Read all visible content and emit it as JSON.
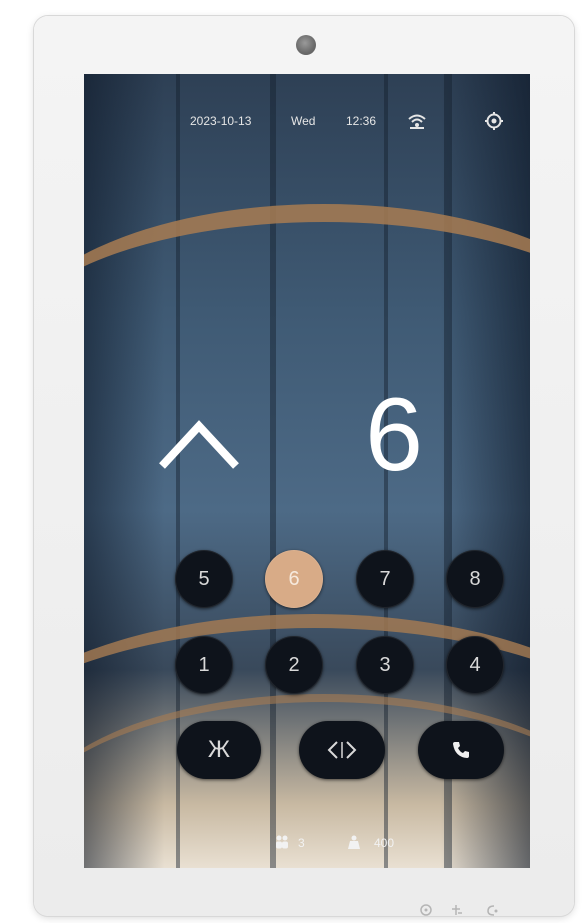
{
  "status_bar": {
    "date": "2023-10-13",
    "weekday": "Wed",
    "time": "12:36",
    "network_icon": "network-icon",
    "settings_icon": "settings-icon"
  },
  "elevator": {
    "direction": "up",
    "current_floor": "6"
  },
  "floor_buttons": [
    {
      "label": "5",
      "active": false
    },
    {
      "label": "6",
      "active": true
    },
    {
      "label": "7",
      "active": false
    },
    {
      "label": "8",
      "active": false
    },
    {
      "label": "1",
      "active": false
    },
    {
      "label": "2",
      "active": false
    },
    {
      "label": "3",
      "active": false
    },
    {
      "label": "4",
      "active": false
    }
  ],
  "control_buttons": {
    "close_door_glyph": "Ж",
    "open_door_icon": "door-open-icon",
    "call_icon": "phone-icon"
  },
  "info_bar": {
    "people_value": "3",
    "weight_value": "400"
  },
  "colors": {
    "active_button": "#d8ab87",
    "button": "#0e131b"
  }
}
